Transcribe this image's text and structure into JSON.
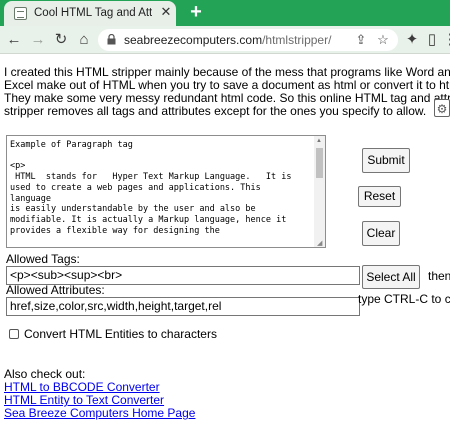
{
  "browser": {
    "tab_title": "Cool HTML Tag and Attribute Onl",
    "url_domain": "seabreezecomputers.com",
    "url_path": "/htmlstripper/"
  },
  "intro_lines": [
    "I created this HTML stripper mainly because of the mess that programs like Word and",
    "Excel make out of HTML when you try to save a document as html or convert it to html.",
    "They make some very messy redundant html code. So this online HTML tag and attribute",
    "stripper removes all tags and attributes except for the ones you specify to allow."
  ],
  "editor_text": "Example of Paragraph tag\n\n<p>\n HTML  stands for   Hyper Text Markup Language.   It is\nused to create a web pages and applications. This\nlanguage\nis easily understandable by the user and also be\nmodifiable. It is actually a Markup language, hence it\nprovides a flexible way for designing the",
  "buttons": {
    "submit": "Submit",
    "reset": "Reset",
    "clear": "Clear",
    "select_all": "Select All"
  },
  "allowed_tags": {
    "label": "Allowed Tags:",
    "value": "<p><sub><sup><br>"
  },
  "allowed_attributes": {
    "label": "Allowed Attributes:",
    "value": "href,size,color,src,width,height,target,rel"
  },
  "select_all_hint_1": "then",
  "select_all_hint_2": "type CTRL-C to c",
  "convert_entities_label": "Convert HTML Entities to characters",
  "also_check_out": "Also check out:",
  "links": [
    "HTML to BBCODE Converter",
    "HTML Entity to Text Converter",
    "Sea Breeze Computers Home Page"
  ]
}
